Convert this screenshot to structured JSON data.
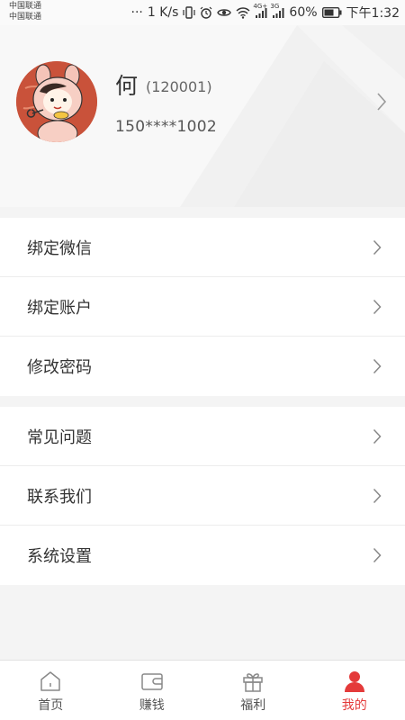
{
  "status_bar": {
    "carrier_1": "中国联通",
    "carrier_2": "中国联通",
    "dots": "···",
    "net_speed": "1 K/s",
    "signal_1_label": "4G+",
    "signal_2_label": "3G",
    "battery": "60%",
    "time": "下午1:32",
    "icons": [
      "vibrate-icon",
      "alarm-icon",
      "eye-icon",
      "wifi-icon",
      "signal-icon",
      "battery-icon"
    ]
  },
  "profile": {
    "name": "何",
    "user_id": "(120001)",
    "phone": "150****1002"
  },
  "menu_group_1": [
    {
      "label": "绑定微信"
    },
    {
      "label": "绑定账户"
    },
    {
      "label": "修改密码"
    }
  ],
  "menu_group_2": [
    {
      "label": "常见问题"
    },
    {
      "label": "联系我们"
    },
    {
      "label": "系统设置"
    }
  ],
  "tab_bar": {
    "tabs": [
      {
        "label": "首页",
        "icon": "home-icon"
      },
      {
        "label": "赚钱",
        "icon": "wallet-icon"
      },
      {
        "label": "福利",
        "icon": "gift-icon"
      },
      {
        "label": "我的",
        "icon": "user-icon"
      }
    ],
    "active": "我的"
  },
  "colors": {
    "accent": "#e43a3a",
    "avatar_bg": "#c9523a"
  }
}
